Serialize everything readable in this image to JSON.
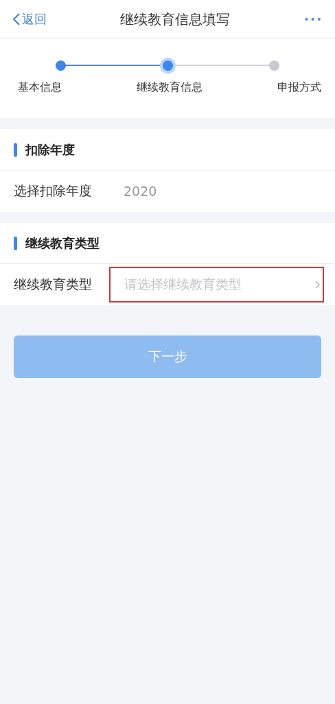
{
  "nav_bar": {
    "back_label": "返回",
    "title": "继续教育信息填写",
    "more": "•••"
  },
  "steps": [
    {
      "label": "基本信息",
      "completed": true,
      "current": false
    },
    {
      "label": "继续教育信息",
      "completed": false,
      "current": true
    },
    {
      "label": "申报方式",
      "completed": false,
      "current": false
    }
  ],
  "sections": [
    {
      "title": "扣除年度",
      "row": {
        "label": "选择扣除年度",
        "value": "2020"
      }
    },
    {
      "title": "继续教育类型",
      "row": {
        "label": "继续教育类型",
        "placeholder": "请选择继续教育类型",
        "highlighted": true
      }
    }
  ],
  "next_button": {
    "label": "下一步",
    "disabled": true
  }
}
